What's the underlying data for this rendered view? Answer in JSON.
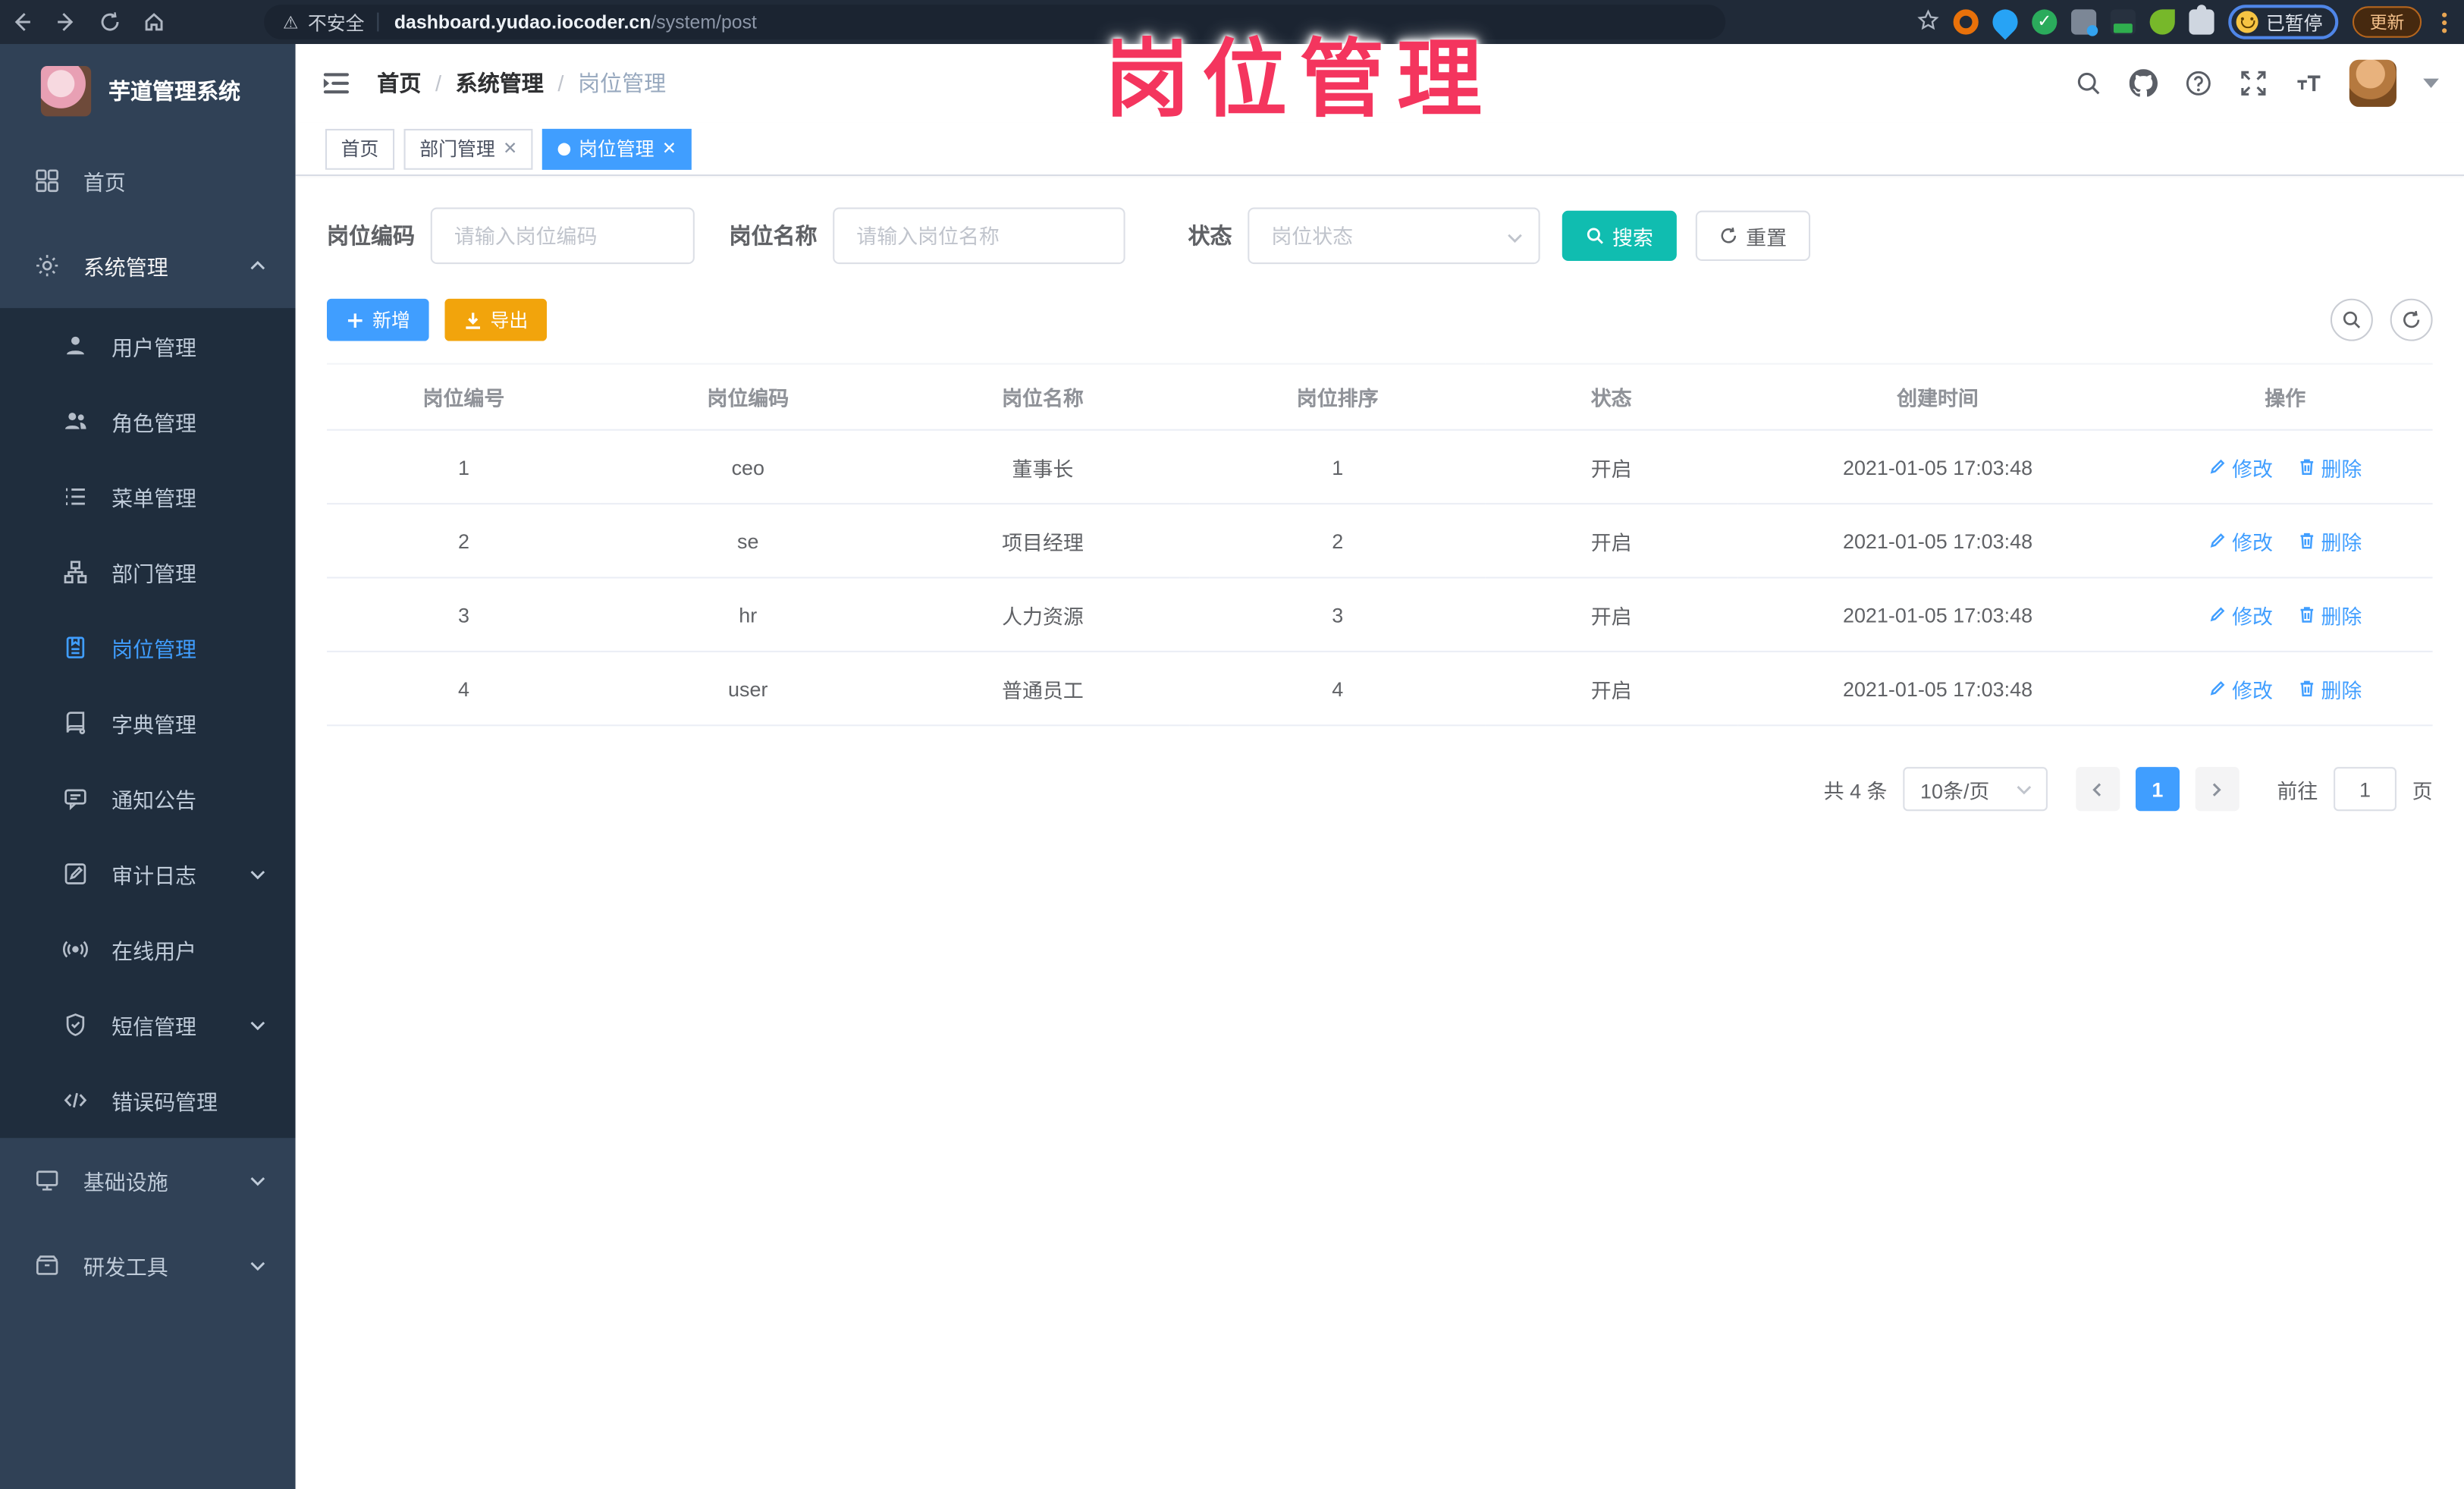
{
  "browser": {
    "security_label": "不安全",
    "url_host": "dashboard.yudao.iocoder.cn",
    "url_path": "/system/post",
    "profile_status": "已暂停",
    "update_label": "更新"
  },
  "overlay": {
    "title": "岗位管理"
  },
  "sidebar": {
    "app_title": "芋道管理系统",
    "items": [
      {
        "label": "首页"
      },
      {
        "label": "系统管理"
      },
      {
        "label": "用户管理"
      },
      {
        "label": "角色管理"
      },
      {
        "label": "菜单管理"
      },
      {
        "label": "部门管理"
      },
      {
        "label": "岗位管理"
      },
      {
        "label": "字典管理"
      },
      {
        "label": "通知公告"
      },
      {
        "label": "审计日志"
      },
      {
        "label": "在线用户"
      },
      {
        "label": "短信管理"
      },
      {
        "label": "错误码管理"
      },
      {
        "label": "基础设施"
      },
      {
        "label": "研发工具"
      }
    ]
  },
  "header": {
    "breadcrumb": [
      "首页",
      "系统管理",
      "岗位管理"
    ],
    "breadcrumb_sep": "/"
  },
  "tabs": [
    {
      "label": "首页"
    },
    {
      "label": "部门管理"
    },
    {
      "label": "岗位管理"
    }
  ],
  "filters": {
    "code_label": "岗位编码",
    "code_placeholder": "请输入岗位编码",
    "name_label": "岗位名称",
    "name_placeholder": "请输入岗位名称",
    "status_label": "状态",
    "status_placeholder": "岗位状态",
    "search_label": "搜索",
    "reset_label": "重置"
  },
  "toolbar": {
    "add_label": "新增",
    "export_label": "导出"
  },
  "table": {
    "columns": [
      "岗位编号",
      "岗位编码",
      "岗位名称",
      "岗位排序",
      "状态",
      "创建时间",
      "操作"
    ],
    "edit_label": "修改",
    "delete_label": "删除",
    "rows": [
      {
        "id": "1",
        "code": "ceo",
        "name": "董事长",
        "sort": "1",
        "status": "开启",
        "created": "2021-01-05 17:03:48"
      },
      {
        "id": "2",
        "code": "se",
        "name": "项目经理",
        "sort": "2",
        "status": "开启",
        "created": "2021-01-05 17:03:48"
      },
      {
        "id": "3",
        "code": "hr",
        "name": "人力资源",
        "sort": "3",
        "status": "开启",
        "created": "2021-01-05 17:03:48"
      },
      {
        "id": "4",
        "code": "user",
        "name": "普通员工",
        "sort": "4",
        "status": "开启",
        "created": "2021-01-05 17:03:48"
      }
    ]
  },
  "pagination": {
    "total": "共 4 条",
    "page_size": "10条/页",
    "current_page": "1",
    "goto_label": "前往",
    "goto_value": "1",
    "goto_unit": "页"
  }
}
